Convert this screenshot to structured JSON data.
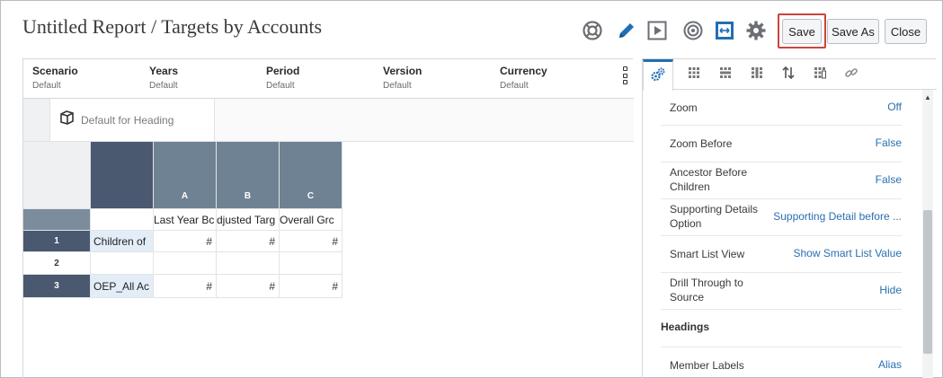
{
  "header": {
    "title": "Untitled Report / Targets by Accounts",
    "buttons": {
      "save": "Save",
      "save_as": "Save As",
      "close": "Close"
    }
  },
  "toolbar_icons": [
    "help-icon",
    "edit-icon",
    "preview-icon",
    "target-icon",
    "fit-width-icon",
    "settings-icon"
  ],
  "pov": [
    {
      "label": "Scenario",
      "value": "Default"
    },
    {
      "label": "Years",
      "value": "Default"
    },
    {
      "label": "Period",
      "value": "Default"
    },
    {
      "label": "Version",
      "value": "Default"
    },
    {
      "label": "Currency",
      "value": "Default"
    }
  ],
  "heading": {
    "label": "Default for Heading"
  },
  "grid": {
    "columns": [
      "A",
      "B",
      "C"
    ],
    "column_titles": [
      "Last Year Bc",
      "djusted Targ",
      "Overall Grc"
    ],
    "rows": [
      {
        "num": "1",
        "label": "Children of",
        "values": [
          "#",
          "#",
          "#"
        ]
      },
      {
        "num": "2",
        "label": "",
        "values": [
          "",
          "",
          ""
        ]
      },
      {
        "num": "3",
        "label": "OEP_All Ac",
        "values": [
          "#",
          "#",
          "#"
        ]
      }
    ]
  },
  "properties": {
    "items": [
      {
        "label": "Zoom",
        "value": "Off"
      },
      {
        "label": "Zoom Before",
        "value": "False"
      },
      {
        "label": "Ancestor Before Children",
        "value": "False"
      },
      {
        "label": "Supporting Details Option",
        "value": "Supporting Detail before ..."
      },
      {
        "label": "Smart List View",
        "value": "Show Smart List Value"
      },
      {
        "label": "Drill Through to Source",
        "value": "Hide"
      }
    ],
    "section": "Headings",
    "section_items": [
      {
        "label": "Member Labels",
        "value": "Alias"
      }
    ]
  },
  "colors": {
    "accent": "#1f6fb5",
    "save_outline": "#c9453b",
    "header_dark": "#4a5870",
    "header_mid": "#6e8294"
  }
}
